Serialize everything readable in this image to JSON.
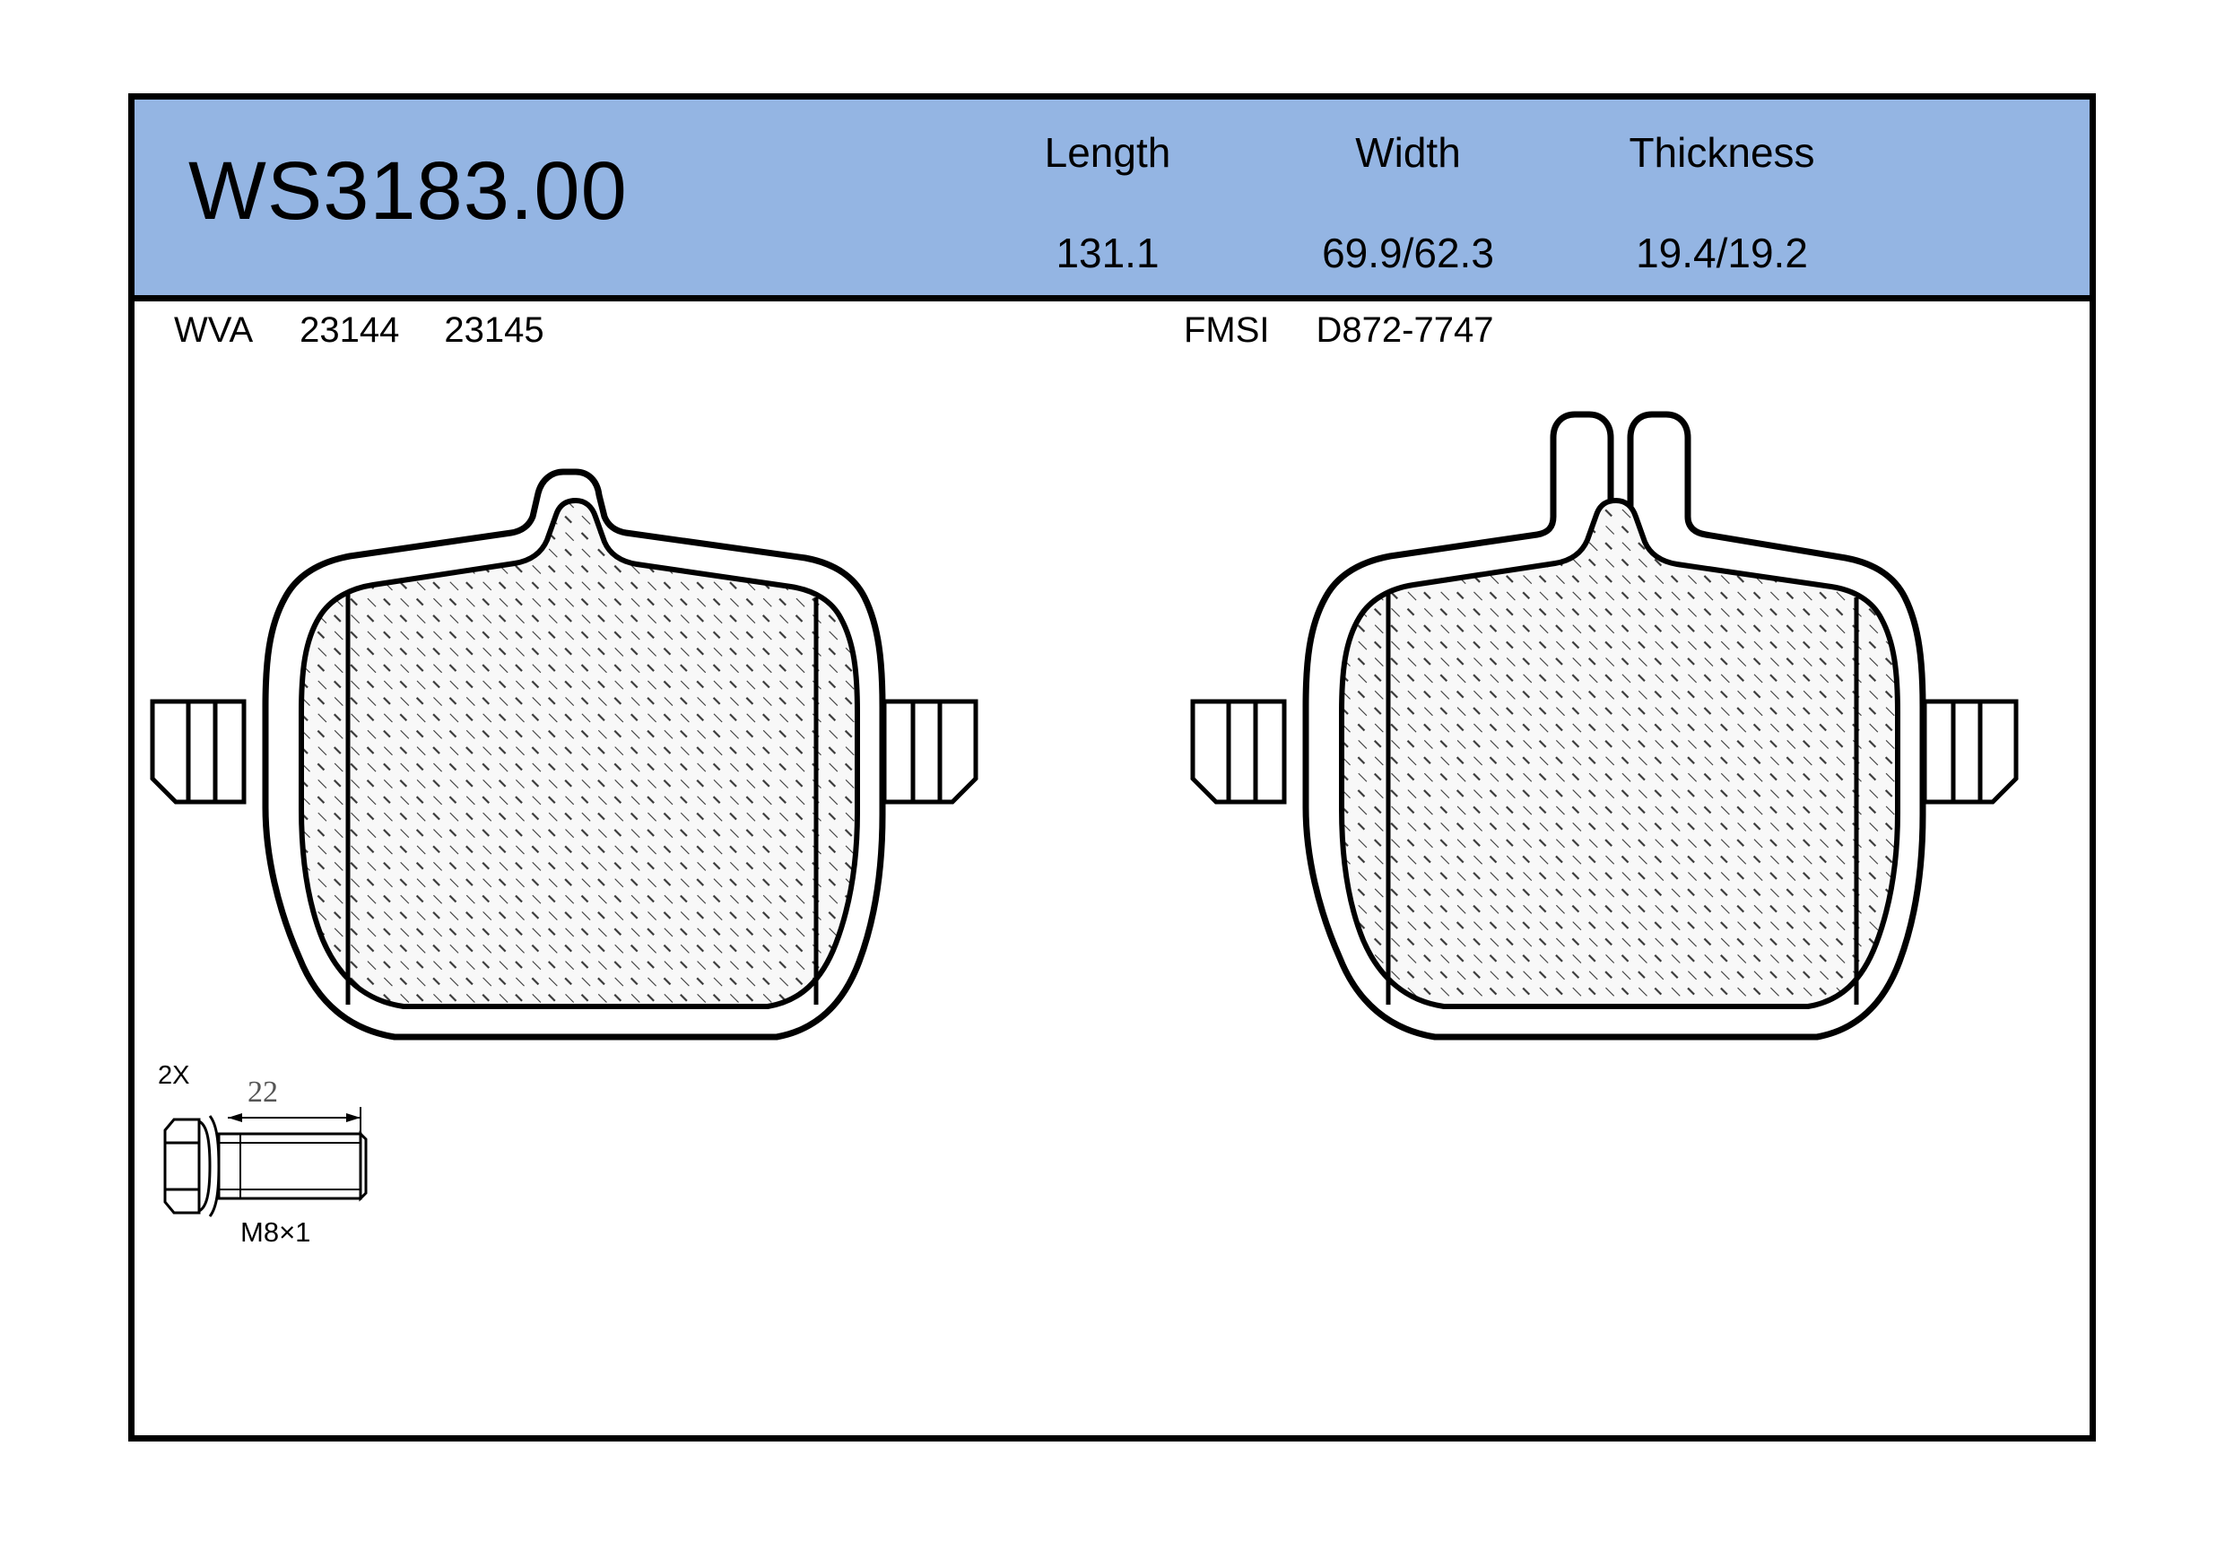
{
  "document": {
    "part_number": "WS3183.00",
    "type": "brake-pad-set-spec-sheet"
  },
  "colors": {
    "header_blue": "#94b5e3",
    "frame_black": "#000000",
    "hatch_fill": "#f7f7f7",
    "sheet_white": "#ffffff"
  },
  "dimensions": {
    "columns": [
      {
        "label": "Length",
        "value": "131.1"
      },
      {
        "label": "Width",
        "value": "69.9/62.3"
      },
      {
        "label": "Thickness",
        "value": "19.4/19.2"
      }
    ]
  },
  "codes": {
    "wva": {
      "label": "WVA",
      "values": [
        "23144",
        "23145"
      ]
    },
    "fmsi": {
      "label": "FMSI",
      "values": [
        "D872-7747"
      ]
    }
  },
  "hardware": {
    "quantity": "2X",
    "length": "22",
    "thread": "M8×1"
  },
  "drawing": {
    "left_pad": {
      "name": "brake-pad-left",
      "feature": "center-slot"
    },
    "right_pad": {
      "name": "brake-pad-right",
      "feature": "wear-sensor-tab"
    }
  }
}
